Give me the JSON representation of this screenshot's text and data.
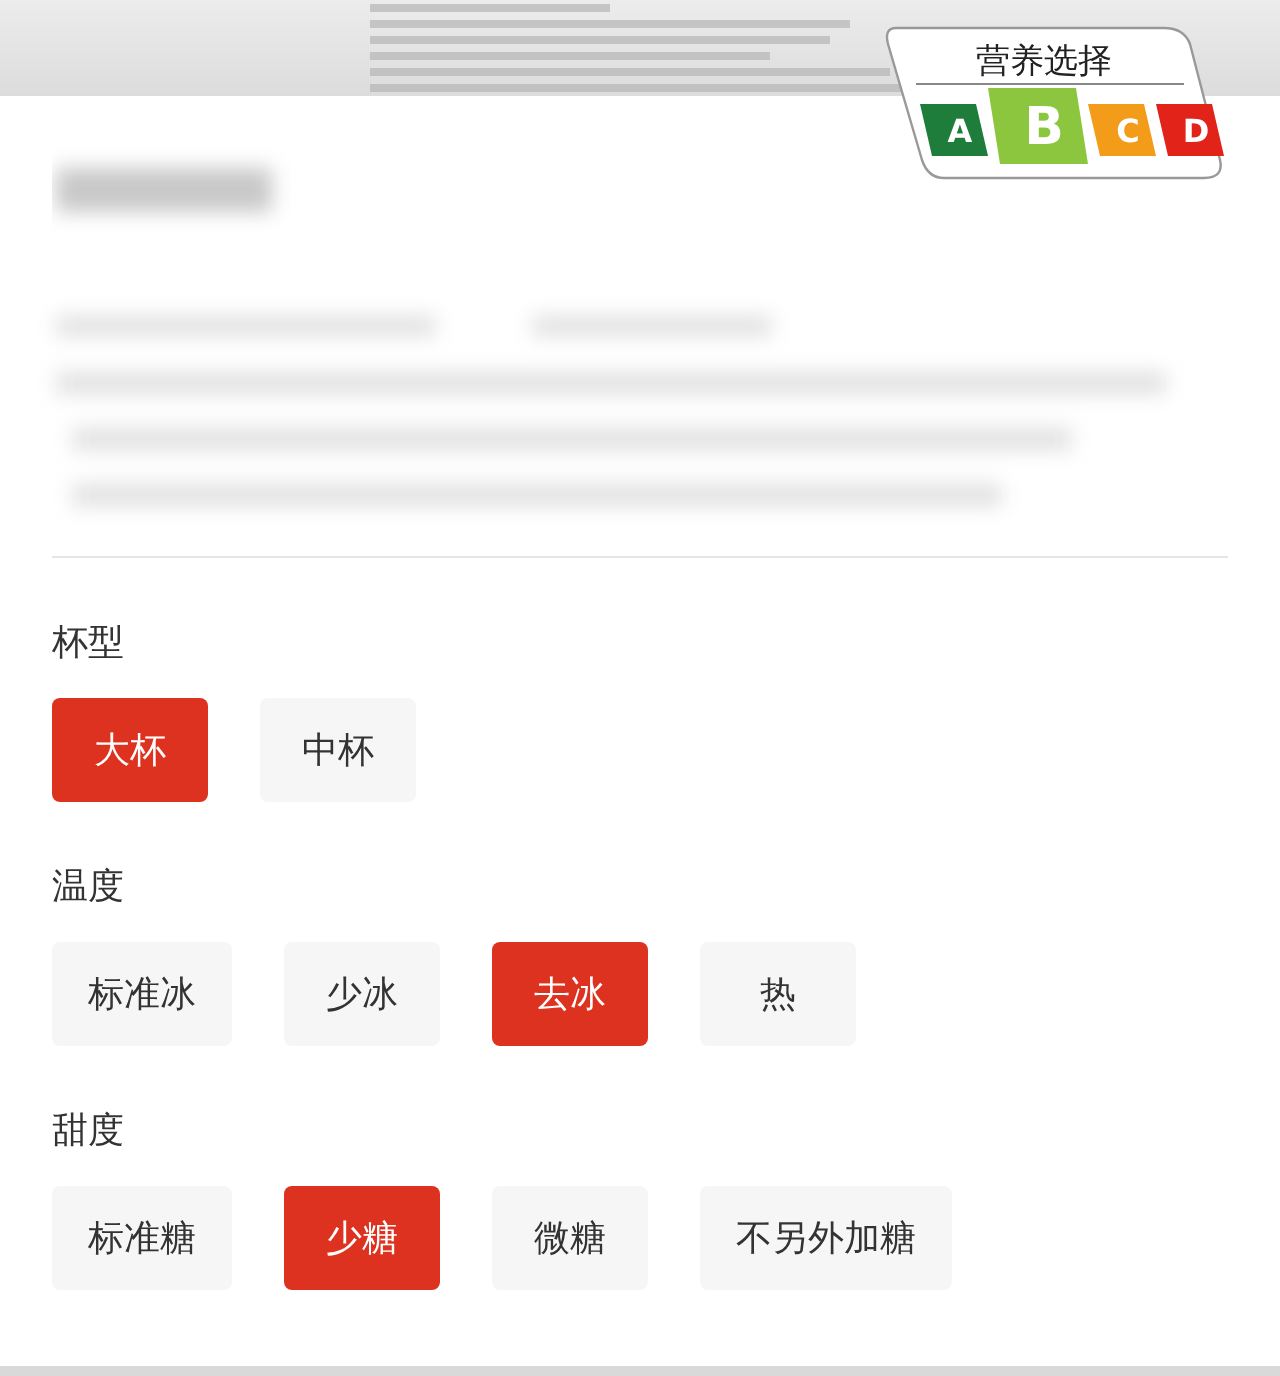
{
  "nutrition_badge": {
    "title": "营养选择",
    "grades": [
      {
        "letter": "A",
        "color": "#1e7d3a",
        "selected": false
      },
      {
        "letter": "B",
        "color": "#8cc63f",
        "selected": true
      },
      {
        "letter": "C",
        "color": "#f39c1a",
        "selected": false
      },
      {
        "letter": "D",
        "color": "#e2231a",
        "selected": false
      }
    ]
  },
  "option_groups": [
    {
      "label": "杯型",
      "options": [
        {
          "label": "大杯",
          "selected": true
        },
        {
          "label": "中杯",
          "selected": false
        }
      ]
    },
    {
      "label": "温度",
      "options": [
        {
          "label": "标准冰",
          "selected": false
        },
        {
          "label": "少冰",
          "selected": false
        },
        {
          "label": "去冰",
          "selected": true
        },
        {
          "label": "热",
          "selected": false
        }
      ]
    },
    {
      "label": "甜度",
      "options": [
        {
          "label": "标准糖",
          "selected": false
        },
        {
          "label": "少糖",
          "selected": true
        },
        {
          "label": "微糖",
          "selected": false
        },
        {
          "label": "不另外加糖",
          "selected": false
        }
      ]
    }
  ]
}
